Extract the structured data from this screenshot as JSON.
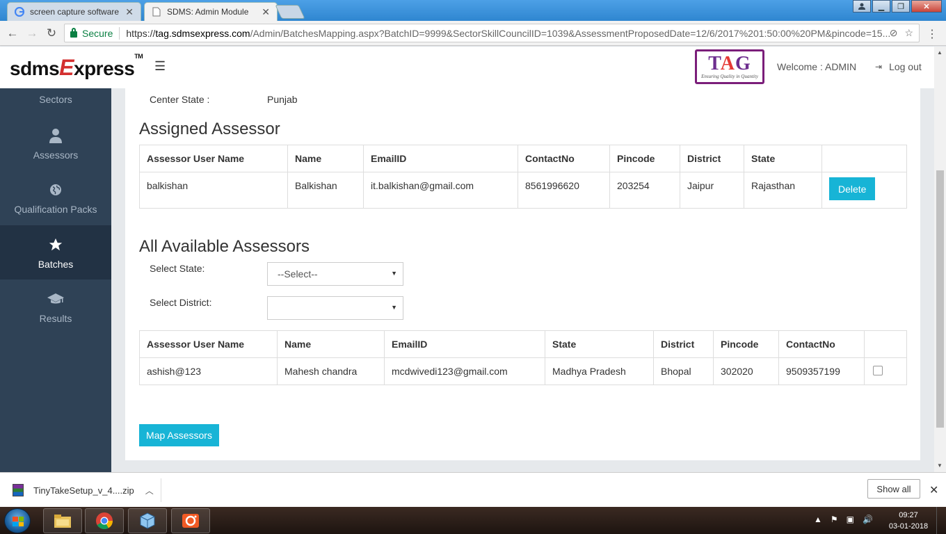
{
  "browser": {
    "tabs": [
      {
        "title": "screen capture software",
        "active": false
      },
      {
        "title": "SDMS: Admin Module",
        "active": true
      }
    ],
    "secure_label": "Secure",
    "url_scheme": "https://",
    "url_host": "tag.sdmsexpress.com",
    "url_path": "/Admin/BatchesMapping.aspx?BatchID=9999&SectorSkillCouncilID=1039&AssessmentProposedDate=12/6/2017%201:50:00%20PM&pincode=15..."
  },
  "header": {
    "logo_pre": "sdms",
    "logo_x": "E",
    "logo_post": "xpress",
    "logo_tm": "TM",
    "tag_logo_left": "T",
    "tag_logo_a": "A",
    "tag_logo_right": "G",
    "tag_tagline": "Ensuring Quality in Quantity",
    "welcome": "Welcome : ADMIN",
    "logout": "Log out"
  },
  "sidebar": {
    "items": [
      {
        "label": "Sectors",
        "icon": "sectors-icon"
      },
      {
        "label": "Assessors",
        "icon": "user-icon"
      },
      {
        "label": "Qualification Packs",
        "icon": "globe-icon"
      },
      {
        "label": "Batches",
        "icon": "star-icon",
        "active": true
      },
      {
        "label": "Results",
        "icon": "graduation-cap-icon"
      }
    ]
  },
  "main": {
    "center_state_label": "Center State :",
    "center_state_value": "Punjab",
    "assigned_title": "Assigned Assessor",
    "assigned_table": {
      "headers": [
        "Assessor User Name",
        "Name",
        "EmailID",
        "ContactNo",
        "Pincode",
        "District",
        "State",
        ""
      ],
      "rows": [
        {
          "user": "balkishan",
          "name": "Balkishan",
          "email": "it.balkishan@gmail.com",
          "contact": "8561996620",
          "pincode": "203254",
          "district": "Jaipur",
          "state": "Rajasthan",
          "action": "Delete"
        }
      ]
    },
    "available_title": "All Available Assessors",
    "select_state_label": "Select State:",
    "select_state_value": "--Select--",
    "select_district_label": "Select District:",
    "select_district_value": "",
    "available_table": {
      "headers": [
        "Assessor User Name",
        "Name",
        "EmailID",
        "State",
        "District",
        "Pincode",
        "ContactNo",
        ""
      ],
      "rows": [
        {
          "user": "ashish@123",
          "name": "Mahesh chandra",
          "email": "mcdwivedi123@gmail.com",
          "state": "Madhya Pradesh",
          "district": "Bhopal",
          "pincode": "302020",
          "contact": "9509357199",
          "checked": false
        }
      ]
    },
    "map_button": "Map Assessors"
  },
  "downloads": {
    "file": "TinyTakeSetup_v_4....zip",
    "show_all": "Show all"
  },
  "taskbar": {
    "time": "09:27",
    "date": "03-01-2018"
  },
  "colors": {
    "accent": "#17b4d6",
    "sidebar_bg": "#2f4256",
    "sidebar_active": "#223244",
    "tag_purple": "#7b1e7a"
  }
}
